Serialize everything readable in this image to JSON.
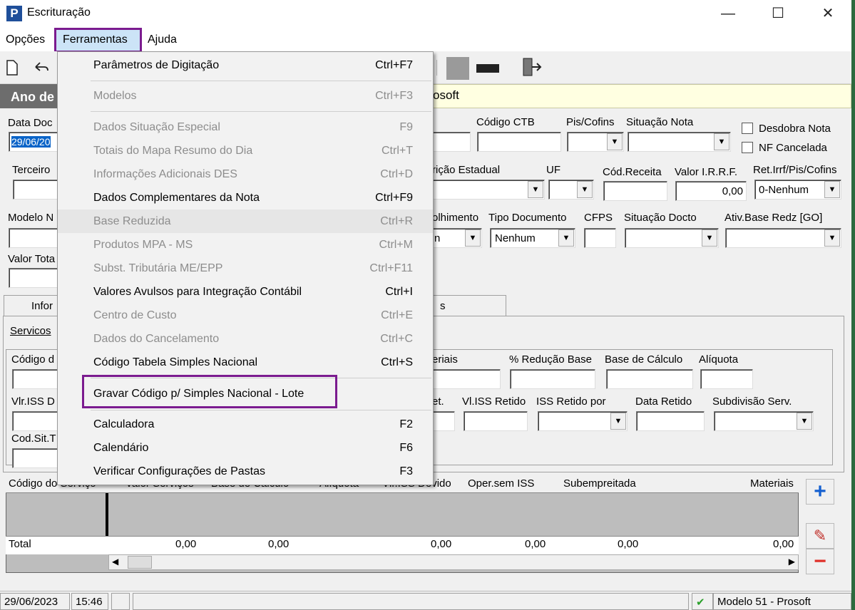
{
  "window": {
    "title": "Escrituração",
    "app_icon": "P",
    "minimize": "—",
    "maximize": "☐",
    "close": "✕"
  },
  "menubar": {
    "items": [
      "Opções",
      "Ferramentas",
      "Ajuda"
    ]
  },
  "header": {
    "dark_label": "Ano de",
    "banner_text": "osoft"
  },
  "form": {
    "data_doc_label": "Data Doc",
    "data_doc_value": "29/06/20",
    "codigo_ctb": "Código CTB",
    "pis_cofins": "Pis/Cofins",
    "situacao_nota": "Situação Nota",
    "desdobra_nota": "Desdobra Nota",
    "nf_cancelada": "NF Cancelada",
    "terceiro": "Terceiro",
    "inscricao_estadual": "rição Estadual",
    "uf": "UF",
    "cod_receita": "Cód.Receita",
    "valor_irrf": "Valor I.R.R.F.",
    "valor_irrf_value": "0,00",
    "ret_irrf": "Ret.Irrf/Pis/Cofins",
    "ret_irrf_value": "0-Nenhum",
    "modelo": "Modelo N",
    "recolhimento": "olhimento",
    "recolhimento_value": "n",
    "tipo_documento": "Tipo Documento",
    "tipo_documento_value": "Nenhum",
    "cfps": "CFPS",
    "situacao_docto": "Situação Docto",
    "ativ_base": "Ativ.Base Redz [GO]",
    "valor_total": "Valor Tota"
  },
  "tabs": {
    "tab1": "Infor",
    "tab2": "s",
    "subtab": "Servicos"
  },
  "servicos": {
    "codigo": "Código d",
    "materiais": "eriais",
    "reducao_base": "% Redução Base",
    "base_calculo": "Base de Cálculo",
    "aliquota": "Alíquota",
    "vlr_iss": "Vlr.ISS D",
    "ret": "et.",
    "vl_iss_retido": "Vl.ISS Retido",
    "iss_retido_por": "ISS Retido por",
    "data_retido": "Data Retido",
    "subdivisao": "Subdivisão Serv.",
    "cod_sit": "Cod.Sit.T"
  },
  "grid": {
    "headers": [
      "Código do Serviço",
      "Valor Serviços",
      "Base de Cálculo",
      "Alíquota",
      "Vlr.ISS Devido",
      "Oper.sem ISS",
      "Subempreitada",
      "Materiais"
    ],
    "total_label": "Total",
    "totals": [
      "0,00",
      "0,00",
      "0,00",
      "0,00",
      "0,00",
      "0,00"
    ]
  },
  "statusbar": {
    "date": "29/06/2023",
    "time": "15:46",
    "modelo": "Modelo 51 - Prosoft"
  },
  "dropdown": {
    "items": [
      {
        "label": "Parâmetros de Digitação",
        "shortcut": "Ctrl+F7",
        "enabled": true
      },
      {
        "label": "Modelos",
        "shortcut": "Ctrl+F3",
        "enabled": false
      },
      {
        "label": "Dados Situação Especial",
        "shortcut": "F9",
        "enabled": false
      },
      {
        "label": "Totais do Mapa Resumo do Dia",
        "shortcut": "Ctrl+T",
        "enabled": false
      },
      {
        "label": "Informações Adicionais DES",
        "shortcut": "Ctrl+D",
        "enabled": false
      },
      {
        "label": "Dados Complementares da Nota",
        "shortcut": "Ctrl+F9",
        "enabled": true
      },
      {
        "label": "Base Reduzida",
        "shortcut": "Ctrl+R",
        "enabled": false
      },
      {
        "label": "Produtos MPA - MS",
        "shortcut": "Ctrl+M",
        "enabled": false
      },
      {
        "label": "Subst. Tributária ME/EPP",
        "shortcut": "Ctrl+F11",
        "enabled": false
      },
      {
        "label": "Valores Avulsos para Integração Contábil",
        "shortcut": "Ctrl+I",
        "enabled": true
      },
      {
        "label": "Centro de Custo",
        "shortcut": "Ctrl+E",
        "enabled": false
      },
      {
        "label": "Dados do Cancelamento",
        "shortcut": "Ctrl+C",
        "enabled": false
      },
      {
        "label": "Código Tabela Simples Nacional",
        "shortcut": "Ctrl+S",
        "enabled": true
      },
      {
        "label": "Gravar Código p/ Simples Nacional - Lote",
        "shortcut": "",
        "enabled": true
      },
      {
        "label": "Calculadora",
        "shortcut": "F2",
        "enabled": true
      },
      {
        "label": "Calendário",
        "shortcut": "F6",
        "enabled": true
      },
      {
        "label": "Verificar Configurações de Pastas",
        "shortcut": "F3",
        "enabled": true
      }
    ]
  },
  "colors": {
    "highlight_border": "#7b1b8f",
    "banner_bg": "#ffffe1",
    "header_bg": "#6d6d6d"
  }
}
